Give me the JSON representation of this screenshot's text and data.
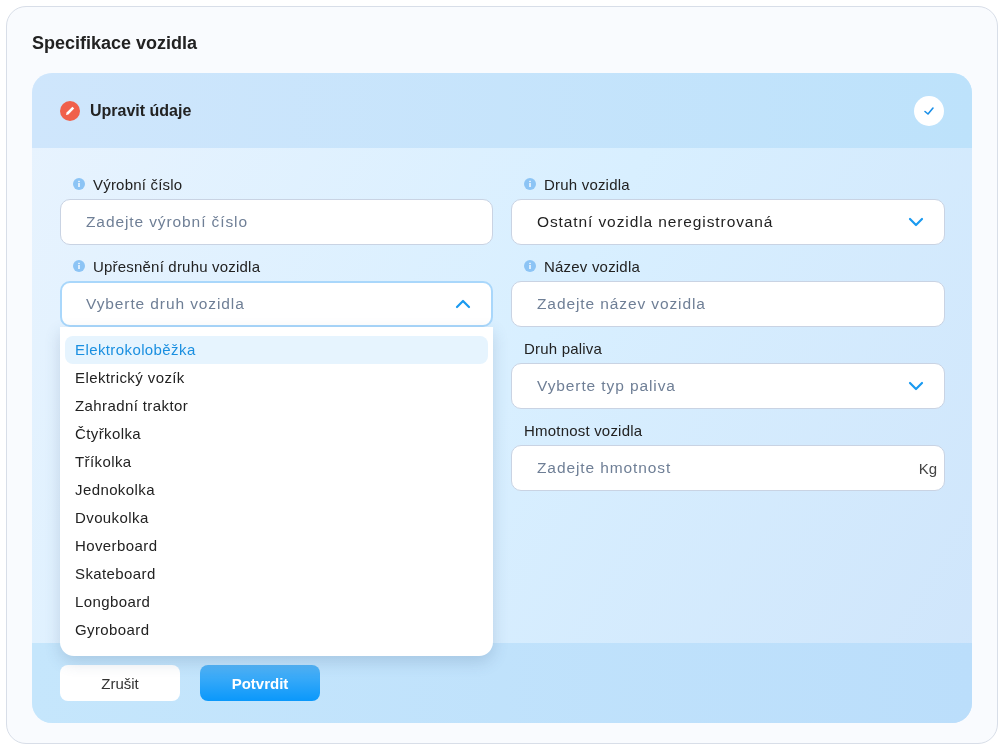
{
  "page_title": "Specifikace vozidla",
  "panel": {
    "title": "Upravit údaje",
    "confirmed": true
  },
  "left_fields": [
    {
      "label": "Výrobní číslo",
      "info": true,
      "kind": "text",
      "placeholder": "Zadejte výrobní číslo"
    },
    {
      "label": "Upřesnění druhu vozidla",
      "info": true,
      "kind": "select",
      "placeholder": "Vyberte druh vozidla",
      "expanded": true,
      "options": [
        {
          "label": "Elektrokoloběžka",
          "selected": true
        },
        {
          "label": "Elektrický vozík",
          "selected": false
        },
        {
          "label": "Zahradní traktor",
          "selected": false
        },
        {
          "label": "Čtyřkolka",
          "selected": false
        },
        {
          "label": "Tříkolka",
          "selected": false
        },
        {
          "label": "Jednokolka",
          "selected": false
        },
        {
          "label": "Dvoukolka",
          "selected": false
        },
        {
          "label": "Hoverboard",
          "selected": false
        },
        {
          "label": "Skateboard",
          "selected": false
        },
        {
          "label": "Longboard",
          "selected": false
        },
        {
          "label": "Gyroboard",
          "selected": false
        }
      ]
    }
  ],
  "right_fields": [
    {
      "label": "Druh vozidla",
      "info": true,
      "kind": "select",
      "value": "Ostatní vozidla neregistrovaná",
      "expanded": false
    },
    {
      "label": "Název vozidla",
      "info": true,
      "kind": "text",
      "placeholder": "Zadejte název vozidla"
    },
    {
      "label": "Druh paliva",
      "info": false,
      "kind": "select",
      "placeholder": "Vyberte typ paliva",
      "expanded": false
    },
    {
      "label": "Hmotnost vozidla",
      "info": false,
      "kind": "unit",
      "placeholder": "Zadejte hmotnost",
      "unit": "Kg"
    }
  ],
  "buttons": [
    {
      "label": "Zrušit",
      "kind": "secondary"
    },
    {
      "label": "Potvrdit",
      "kind": "primary"
    }
  ]
}
